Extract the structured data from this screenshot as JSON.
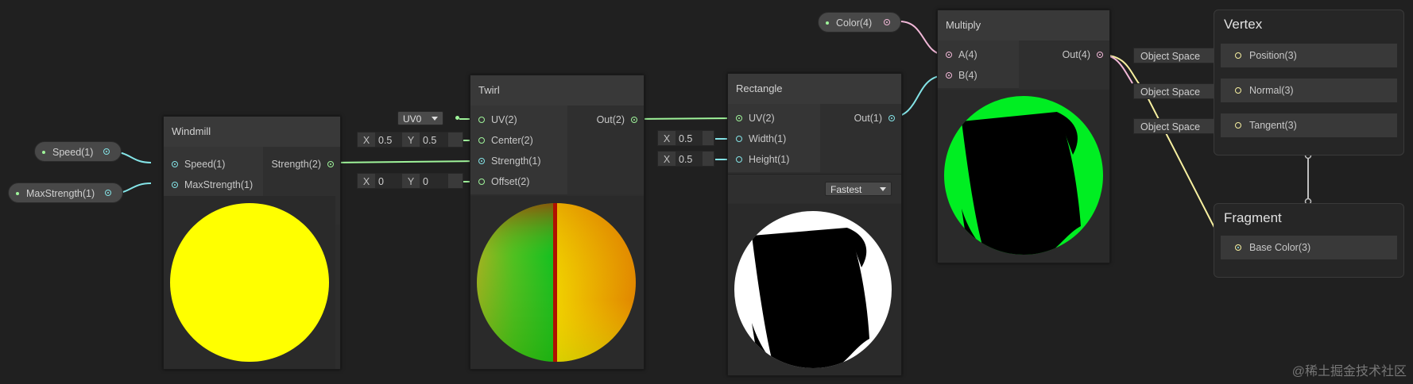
{
  "colors": {
    "background": "#202020",
    "node": "#2d2d2d",
    "wire_vec1": "#84e4e7",
    "wire_vec2": "#9ff49a",
    "wire_vec4": "#f2b8d8",
    "wire_vec3": "#f7f0a0"
  },
  "properties": {
    "speed": "Speed(1)",
    "max_strength": "MaxStrength(1)",
    "color": "Color(4)"
  },
  "windmill": {
    "title": "Windmill",
    "inputs": [
      "Speed(1)",
      "MaxStrength(1)"
    ],
    "output": "Strength(2)",
    "preview_color": "#ffff00"
  },
  "twirl": {
    "title": "Twirl",
    "inputs": [
      "UV(2)",
      "Center(2)",
      "Strength(1)",
      "Offset(2)"
    ],
    "output": "Out(2)",
    "uv_dropdown": "UV0",
    "center": {
      "x_label": "X",
      "x": "0.5",
      "y_label": "Y",
      "y": "0.5"
    },
    "offset": {
      "x_label": "X",
      "x": "0",
      "y_label": "Y",
      "y": "0"
    }
  },
  "rectangle": {
    "title": "Rectangle",
    "inputs": [
      "UV(2)",
      "Width(1)",
      "Height(1)"
    ],
    "output": "Out(1)",
    "width": {
      "label": "X",
      "value": "0.5"
    },
    "height": {
      "label": "X",
      "value": "0.5"
    },
    "mode": "Fastest"
  },
  "multiply": {
    "title": "Multiply",
    "inputs": [
      "A(4)",
      "B(4)"
    ],
    "output": "Out(4)"
  },
  "vertex": {
    "title": "Vertex",
    "blocks": [
      "Position(3)",
      "Normal(3)",
      "Tangent(3)"
    ],
    "space": [
      "Object Space",
      "Object Space",
      "Object Space"
    ]
  },
  "fragment": {
    "title": "Fragment",
    "blocks": [
      "Base Color(3)"
    ]
  },
  "watermark": "@稀土掘金技术社区"
}
